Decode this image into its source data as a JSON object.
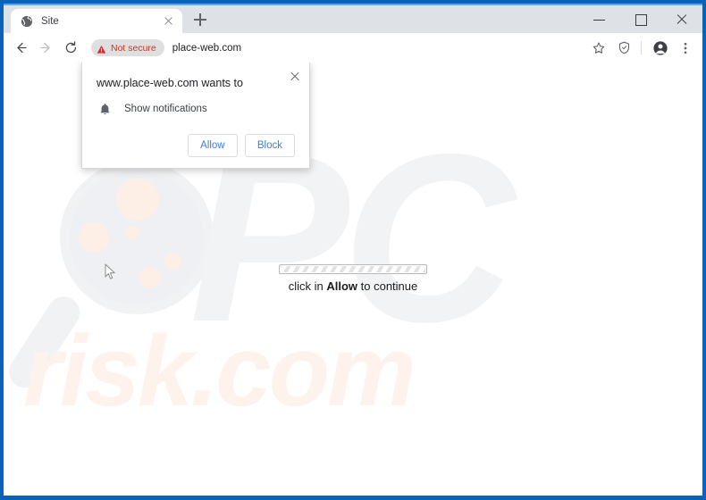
{
  "window": {
    "controls": {
      "minimize": "minimize-button",
      "maximize": "maximize-button",
      "close": "close-button"
    }
  },
  "tabstrip": {
    "tabs": [
      {
        "title": "Site",
        "favicon": "globe-icon",
        "close": "close-tab-icon"
      }
    ],
    "new_tab_label": "+"
  },
  "toolbar": {
    "back": "back-arrow-icon",
    "forward": "forward-arrow-icon",
    "reload": "reload-icon",
    "security_badge": "Not secure",
    "security_icon": "warning-triangle-icon",
    "url": "place-web.com",
    "bookmark": "star-icon",
    "shield": "shield-icon",
    "profile": "profile-avatar-icon",
    "menu": "three-dot-menu-icon"
  },
  "popup": {
    "title": "www.place-web.com wants to",
    "permission_icon": "bell-icon",
    "permission_label": "Show notifications",
    "allow_label": "Allow",
    "block_label": "Block",
    "close_icon": "close-icon"
  },
  "page": {
    "caption_prefix": "click in ",
    "caption_emphasis": "Allow",
    "caption_suffix": " to continue",
    "progress_aria": "loading-progress-bar",
    "watermark_pc": "PC",
    "watermark_risk": "risk.com",
    "cursor": "mouse-pointer"
  },
  "colors": {
    "window_border": "#0b62b8",
    "tabstrip": "#dee1e6",
    "accent_blue": "#3d7de0",
    "not_secure_red": "#c0392b",
    "watermark_gray": "#f2f3f4",
    "watermark_peach": "#fdf3ec"
  }
}
